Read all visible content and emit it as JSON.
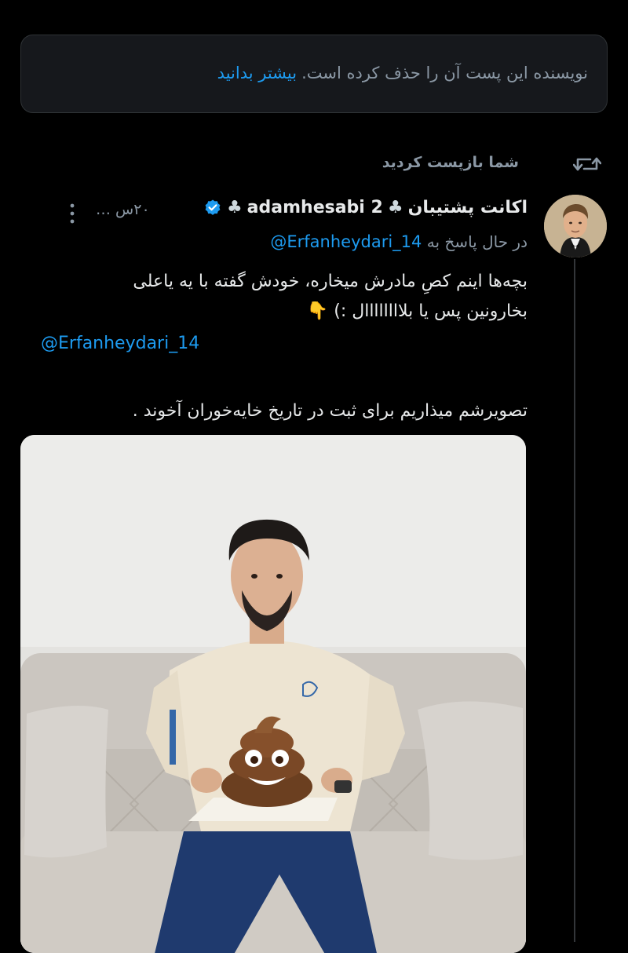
{
  "notice": {
    "text": "نویسنده این پست آن را حذف کرده است.",
    "link": "بیشتر بدانید"
  },
  "repost": {
    "label": "شما بازپست کردید",
    "icon": "repost-icon"
  },
  "post": {
    "name_text": "اکانت پشتیبان",
    "name_club_1": "♣",
    "name_handle_part": "adamhesabi 2",
    "name_club_2": "♣",
    "verified_icon": "verified-badge-icon",
    "time": "۲۰س …",
    "more_icon": "more-vertical-icon",
    "reply_prefix": "در حال پاسخ به",
    "reply_mention": "@Erfanheydari_14",
    "body_line1": "بچه‌ها اینم کصِ مادرش میخاره، خودش گفته با یه یاعلی",
    "body_line2": "بخارونین پس یا بلاااااااال :) 👇",
    "body_mention": "@Erfanheydari_14",
    "body_line3": "تصویرشم میذاریم برای ثبت در تاریخ خایه‌خوران آخوند .",
    "media_alt": "photo"
  },
  "colors": {
    "background": "#000000",
    "accent": "#1d9bf0",
    "muted": "#8b98a5",
    "text": "#e7e9ea"
  }
}
